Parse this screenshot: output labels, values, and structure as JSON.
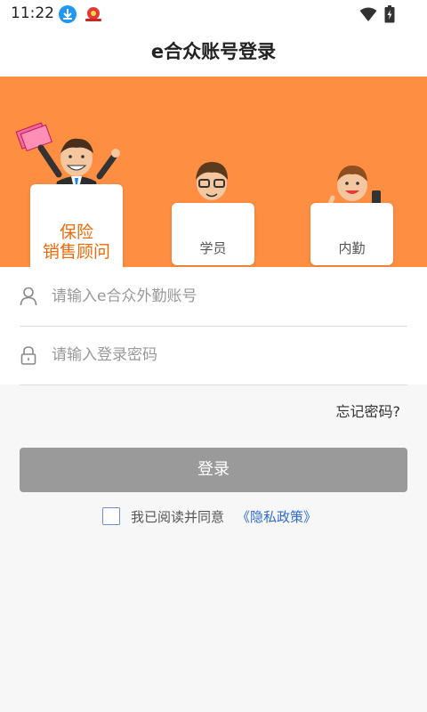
{
  "status_bar": {
    "time": "11:22",
    "icons": [
      "download-icon",
      "app-notification-icon",
      "wifi-icon",
      "battery-charging-icon"
    ]
  },
  "header": {
    "title": "e合众账号登录"
  },
  "banner": {
    "background_color": "#fe8e42",
    "roles": [
      {
        "label_line1": "保险",
        "label_line2": "销售顾问",
        "selected": true
      },
      {
        "label": "学员",
        "selected": false
      },
      {
        "label": "内勤",
        "selected": false
      }
    ]
  },
  "form": {
    "account_placeholder": "请输入e合众外勤账号",
    "account_value": "",
    "password_placeholder": "请输入登录密码",
    "password_value": "",
    "forgot_password": "忘记密码?",
    "login_button": "登录"
  },
  "agreement": {
    "checked": false,
    "text": "我已阅读并同意",
    "policy_link": "《隐私政策》"
  },
  "colors": {
    "accent": "#fe8e42",
    "advisor_label": "#f06a0a",
    "button_disabled": "#9a9a9a",
    "link": "#2f6bd8"
  }
}
